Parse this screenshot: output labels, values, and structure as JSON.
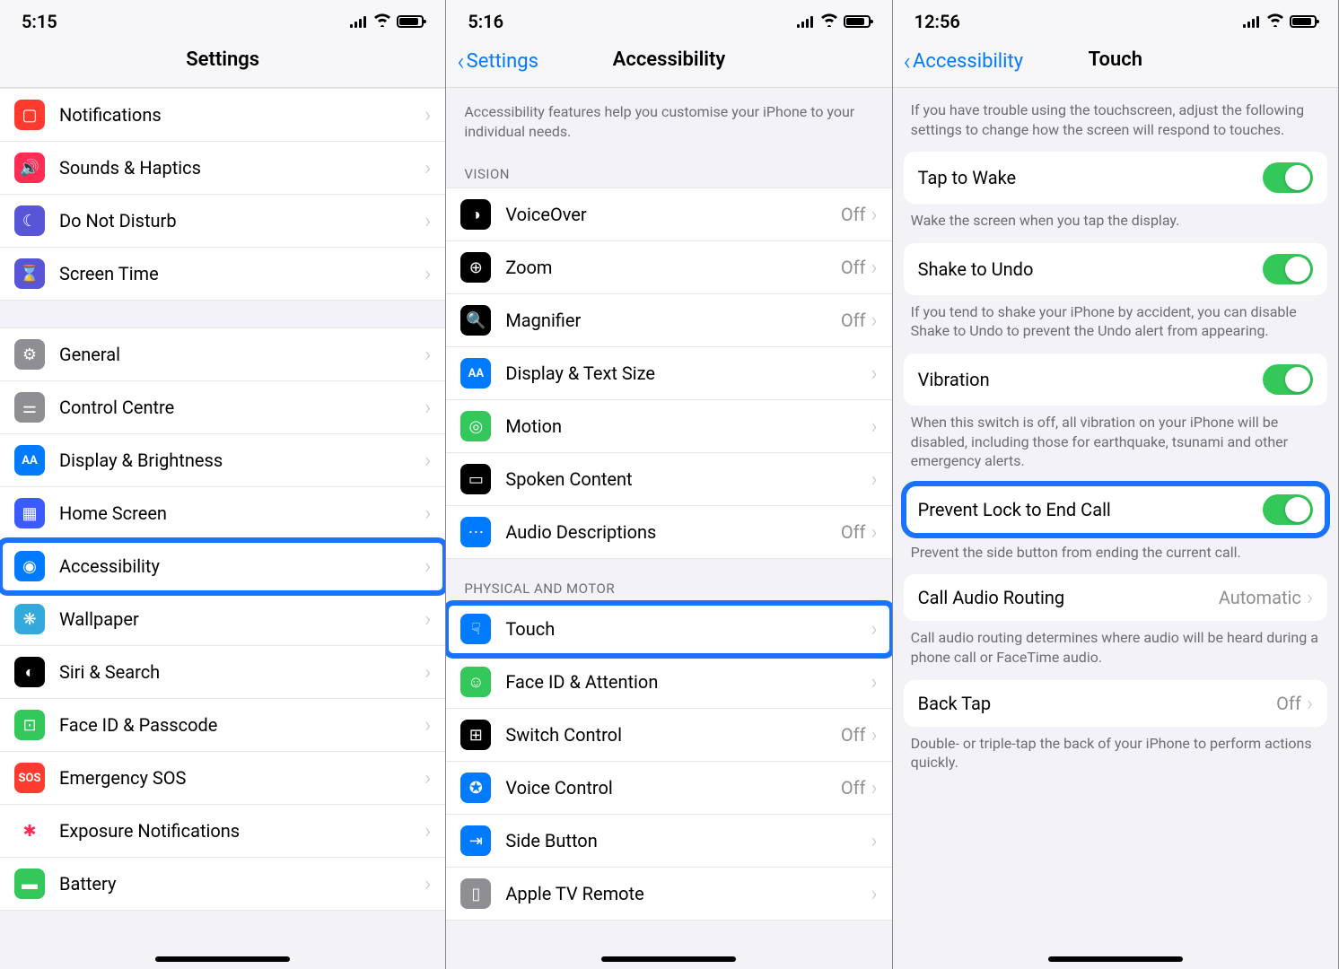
{
  "panel1": {
    "time": "5:15",
    "title": "Settings",
    "groups": [
      [
        {
          "icon": "notif",
          "bg": "#ff3b30",
          "label": "Notifications"
        },
        {
          "icon": "sound",
          "bg": "#ff2d55",
          "label": "Sounds & Haptics"
        },
        {
          "icon": "dnd",
          "bg": "#5856d6",
          "label": "Do Not Disturb"
        },
        {
          "icon": "hourglass",
          "bg": "#5856d6",
          "label": "Screen Time"
        }
      ],
      [
        {
          "icon": "gear",
          "bg": "#8e8e93",
          "label": "General"
        },
        {
          "icon": "switches",
          "bg": "#8e8e93",
          "label": "Control Centre"
        },
        {
          "icon": "aa",
          "bg": "#007aff",
          "label": "Display & Brightness"
        },
        {
          "icon": "grid",
          "bg": "#3b5bff",
          "label": "Home Screen"
        },
        {
          "icon": "access",
          "bg": "#007aff",
          "label": "Accessibility",
          "highlight": true
        },
        {
          "icon": "flower",
          "bg": "#34aadc",
          "label": "Wallpaper"
        },
        {
          "icon": "siri",
          "bg": "#000",
          "label": "Siri & Search"
        },
        {
          "icon": "faceid",
          "bg": "#34c759",
          "label": "Face ID & Passcode"
        },
        {
          "icon": "sos",
          "bg": "#ff3b30",
          "label": "Emergency SOS"
        },
        {
          "icon": "exposure",
          "bg": "#fff",
          "label": "Exposure Notifications",
          "fg": "#ff2d55"
        },
        {
          "icon": "battery",
          "bg": "#34c759",
          "label": "Battery"
        }
      ]
    ]
  },
  "panel2": {
    "time": "5:16",
    "back": "Settings",
    "title": "Accessibility",
    "intro": "Accessibility features help you customise your iPhone to your individual needs.",
    "sections": [
      {
        "header": "VISION",
        "rows": [
          {
            "icon": "voiceover",
            "bg": "#000",
            "label": "VoiceOver",
            "value": "Off"
          },
          {
            "icon": "zoom",
            "bg": "#000",
            "label": "Zoom",
            "value": "Off"
          },
          {
            "icon": "magnifier",
            "bg": "#000",
            "label": "Magnifier",
            "value": "Off"
          },
          {
            "icon": "aa",
            "bg": "#007aff",
            "label": "Display & Text Size"
          },
          {
            "icon": "motion",
            "bg": "#34c759",
            "label": "Motion"
          },
          {
            "icon": "spoken",
            "bg": "#000",
            "label": "Spoken Content"
          },
          {
            "icon": "audio",
            "bg": "#007aff",
            "label": "Audio Descriptions",
            "value": "Off"
          }
        ]
      },
      {
        "header": "PHYSICAL AND MOTOR",
        "rows": [
          {
            "icon": "touch",
            "bg": "#007aff",
            "label": "Touch",
            "highlight": true
          },
          {
            "icon": "face",
            "bg": "#34c759",
            "label": "Face ID & Attention"
          },
          {
            "icon": "switch",
            "bg": "#000",
            "label": "Switch Control",
            "value": "Off"
          },
          {
            "icon": "voice",
            "bg": "#007aff",
            "label": "Voice Control",
            "value": "Off"
          },
          {
            "icon": "side",
            "bg": "#007aff",
            "label": "Side Button"
          },
          {
            "icon": "remote",
            "bg": "#8e8e93",
            "label": "Apple TV Remote"
          }
        ]
      }
    ]
  },
  "panel3": {
    "time": "12:56",
    "back": "Accessibility",
    "title": "Touch",
    "intro": "If you have trouble using the touchscreen, adjust the following settings to change how the screen will respond to touches.",
    "items": [
      {
        "type": "toggle",
        "label": "Tap to Wake",
        "on": true,
        "footer": "Wake the screen when you tap the display."
      },
      {
        "type": "toggle",
        "label": "Shake to Undo",
        "on": true,
        "footer": "If you tend to shake your iPhone by accident, you can disable Shake to Undo to prevent the Undo alert from appearing."
      },
      {
        "type": "toggle",
        "label": "Vibration",
        "on": true,
        "footer": "When this switch is off, all vibration on your iPhone will be disabled, including those for earthquake, tsunami and other emergency alerts."
      },
      {
        "type": "toggle",
        "label": "Prevent Lock to End Call",
        "on": true,
        "highlight": true,
        "footer": "Prevent the side button from ending the current call."
      },
      {
        "type": "link",
        "label": "Call Audio Routing",
        "value": "Automatic",
        "footer": "Call audio routing determines where audio will be heard during a phone call or FaceTime audio."
      },
      {
        "type": "link",
        "label": "Back Tap",
        "value": "Off",
        "footer": "Double- or triple-tap the back of your iPhone to perform actions quickly."
      }
    ]
  }
}
